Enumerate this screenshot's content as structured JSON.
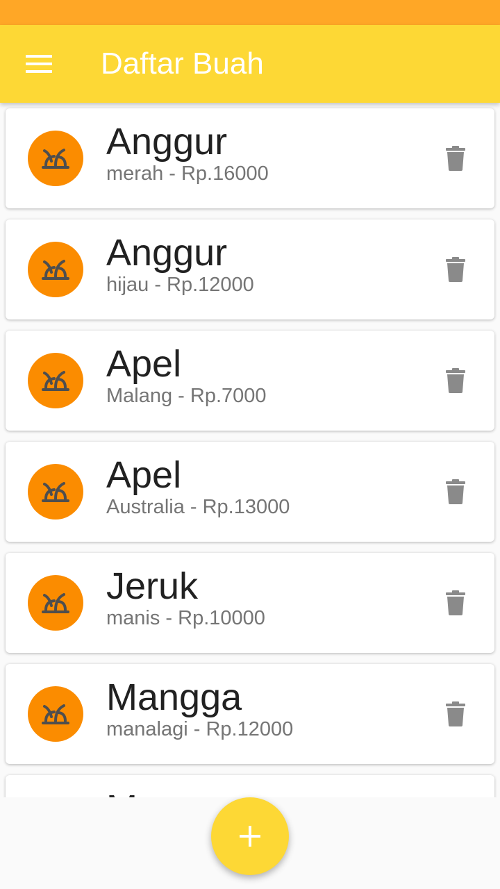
{
  "app_bar": {
    "title": "Daftar Buah",
    "menu_icon": "menu-icon",
    "color": "#FDD835",
    "status_bar_color": "#FFA726"
  },
  "list": {
    "items": [
      {
        "name": "Anggur",
        "subtitle": "merah - Rp.16000"
      },
      {
        "name": "Anggur",
        "subtitle": "hijau - Rp.12000"
      },
      {
        "name": "Apel",
        "subtitle": "Malang - Rp.7000"
      },
      {
        "name": "Apel",
        "subtitle": "Australia - Rp.13000"
      },
      {
        "name": "Jeruk",
        "subtitle": "manis - Rp.10000"
      },
      {
        "name": "Mangga",
        "subtitle": "manalagi - Rp.12000"
      },
      {
        "name": "M",
        "subtitle": ""
      }
    ],
    "avatar_icon": "plant-icon",
    "avatar_color": "#FB8C00",
    "delete_icon": "trash-icon"
  },
  "fab": {
    "icon": "add-icon",
    "color": "#FDD835"
  }
}
